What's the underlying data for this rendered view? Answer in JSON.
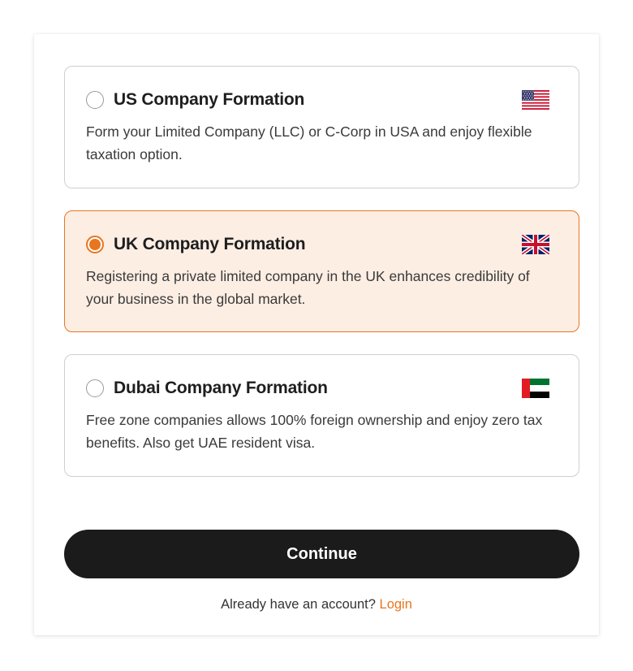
{
  "options": [
    {
      "title": "US Company Formation",
      "description": "Form your Limited Company (LLC) or C-Corp in USA and enjoy flexible taxation option.",
      "flag": "us-flag-icon",
      "selected": false
    },
    {
      "title": "UK Company Formation",
      "description": "Registering a private limited company in the UK enhances credibility of your business in the global market.",
      "flag": "uk-flag-icon",
      "selected": true
    },
    {
      "title": "Dubai Company Formation",
      "description": "Free zone companies allows 100% foreign ownership and enjoy zero tax benefits. Also get UAE resident visa.",
      "flag": "uae-flag-icon",
      "selected": false
    }
  ],
  "continue_label": "Continue",
  "footer": {
    "prompt": "Already have an account?",
    "login_label": "Login"
  },
  "colors": {
    "accent": "#e8761f",
    "selected_background": "#fdeee4",
    "button_background": "#1b1b1b"
  }
}
